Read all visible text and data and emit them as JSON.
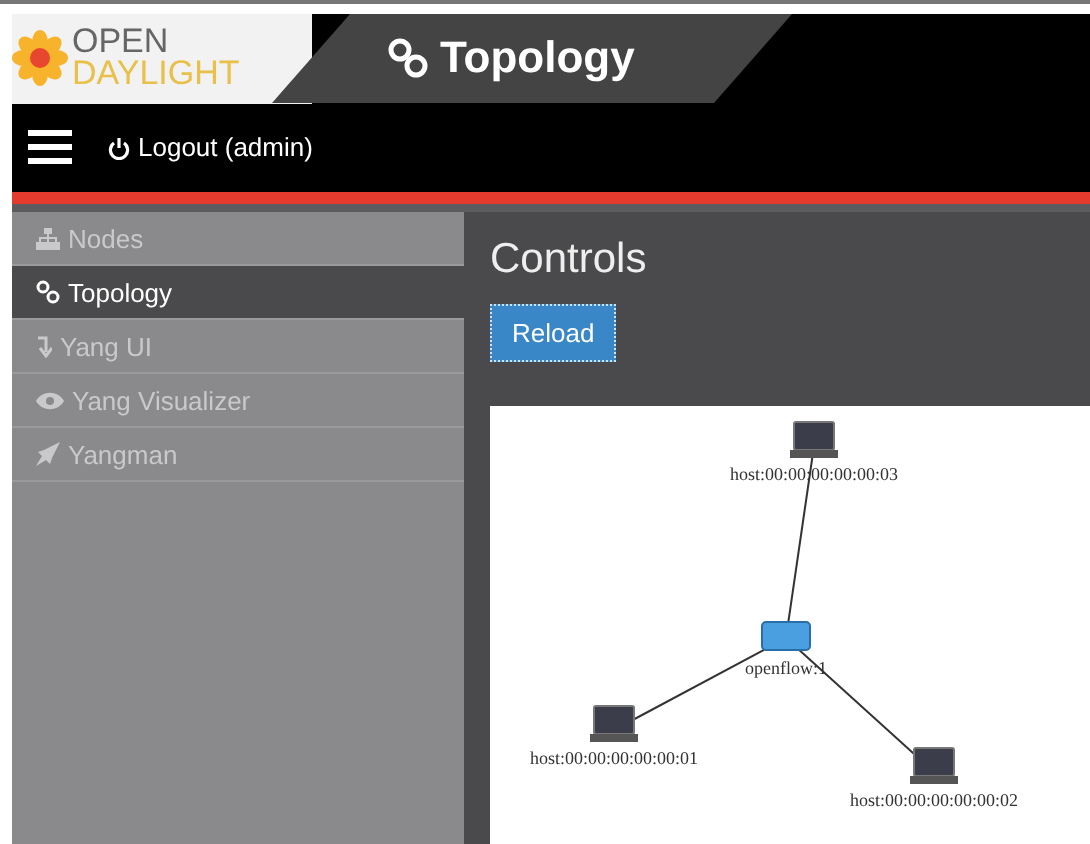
{
  "logo": {
    "line_1": "OPEN",
    "line_2": "DAYLIGHT"
  },
  "header": {
    "title": "Topology"
  },
  "navbar": {
    "logout": "Logout (admin)"
  },
  "sidebar": {
    "items": [
      {
        "label": "Nodes",
        "kind": "nodes",
        "selected": false
      },
      {
        "label": "Topology",
        "kind": "topology",
        "selected": true
      },
      {
        "label": "Yang UI",
        "kind": "yangui",
        "selected": false
      },
      {
        "label": "Yang Visualizer",
        "kind": "visualizer",
        "selected": false
      },
      {
        "label": "Yangman",
        "kind": "yangman",
        "selected": false
      }
    ]
  },
  "main": {
    "heading": "Controls",
    "reload_button": "Reload"
  },
  "topology": {
    "nodes": [
      {
        "kind": "host",
        "label": "host:00:00:00:00:00:03"
      },
      {
        "kind": "switch",
        "label": "openflow:1"
      },
      {
        "kind": "host",
        "label": "host:00:00:00:00:00:01"
      },
      {
        "kind": "host",
        "label": "host:00:00:00:00:00:02"
      }
    ]
  }
}
